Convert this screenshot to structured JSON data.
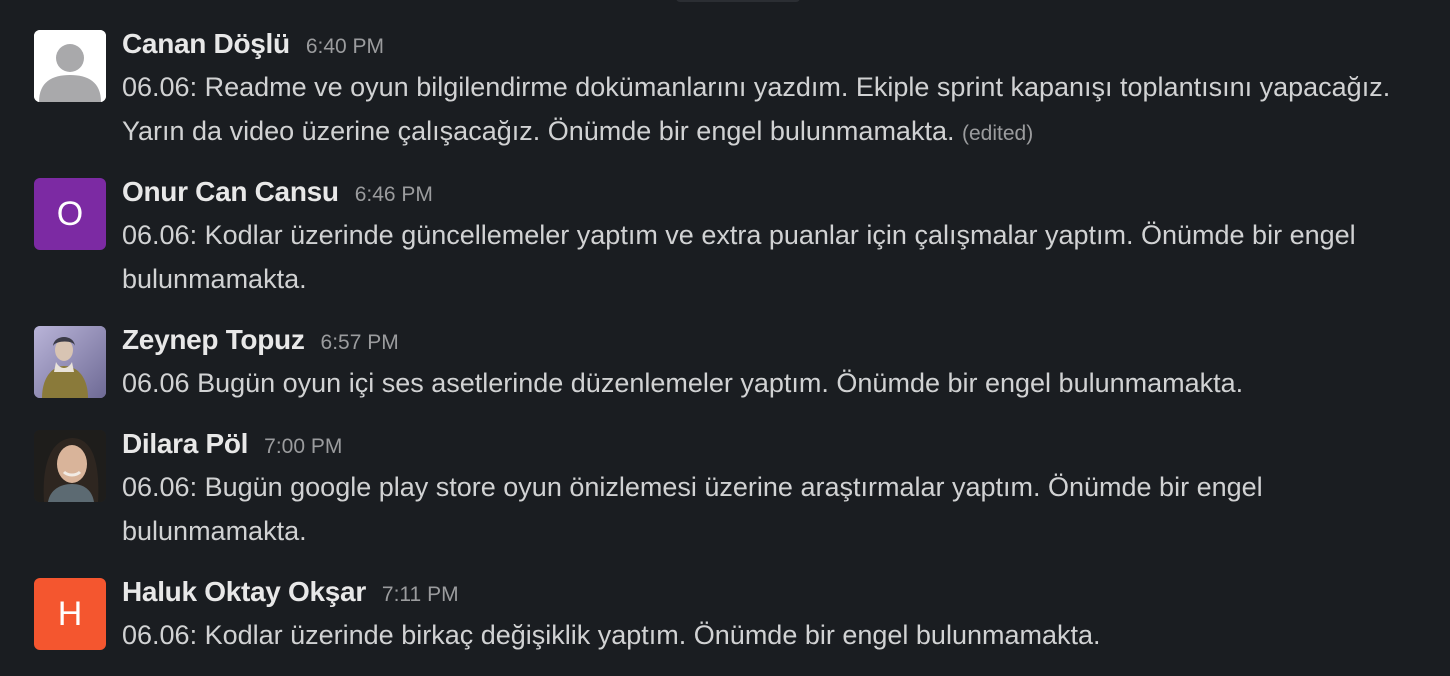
{
  "messages": [
    {
      "author": "Canan Döşlü",
      "time": "6:40 PM",
      "text": "06.06: Readme ve oyun bilgilendirme dokümanlarını yazdım. Ekiple sprint kapanışı toplantısını yapacağız. Yarın da video üzerine çalışacağız. Önümde bir engel bulunmamakta.",
      "edited": "(edited)",
      "avatar": {
        "type": "default-user",
        "icon": "user-silhouette-icon",
        "bg": "#ffffff",
        "fg": "#a9a9ab"
      }
    },
    {
      "author": "Onur Can Cansu",
      "time": "6:46 PM",
      "text": "06.06: Kodlar üzerinde güncellemeler yaptım ve extra puanlar için çalışmalar yaptım. Önümde bir engel bulunmamakta.",
      "avatar": {
        "type": "initial",
        "initial": "O",
        "bg": "#7c2aa3"
      }
    },
    {
      "author": "Zeynep Topuz",
      "time": "6:57 PM",
      "text": "06.06 Bugün oyun içi ses asetlerinde düzenlemeler yaptım. Önümde bir engel bulunmamakta.",
      "avatar": {
        "type": "photo",
        "icon": "profile-photo-icon",
        "bg": "#8f8bb5"
      }
    },
    {
      "author": "Dilara Pöl",
      "time": "7:00 PM",
      "text": "06.06: Bugün google play store oyun önizlemesi üzerine araştırmalar yaptım. Önümde bir engel bulunmamakta.",
      "avatar": {
        "type": "photo",
        "icon": "profile-photo-icon",
        "bg": "#2c2a26"
      }
    },
    {
      "author": "Haluk Oktay Okşar",
      "time": "7:11 PM",
      "text": "06.06: Kodlar üzerinde birkaç değişiklik yaptım. Önümde bir engel bulunmamakta.",
      "avatar": {
        "type": "initial",
        "initial": "H",
        "bg": "#f4562f"
      }
    }
  ]
}
